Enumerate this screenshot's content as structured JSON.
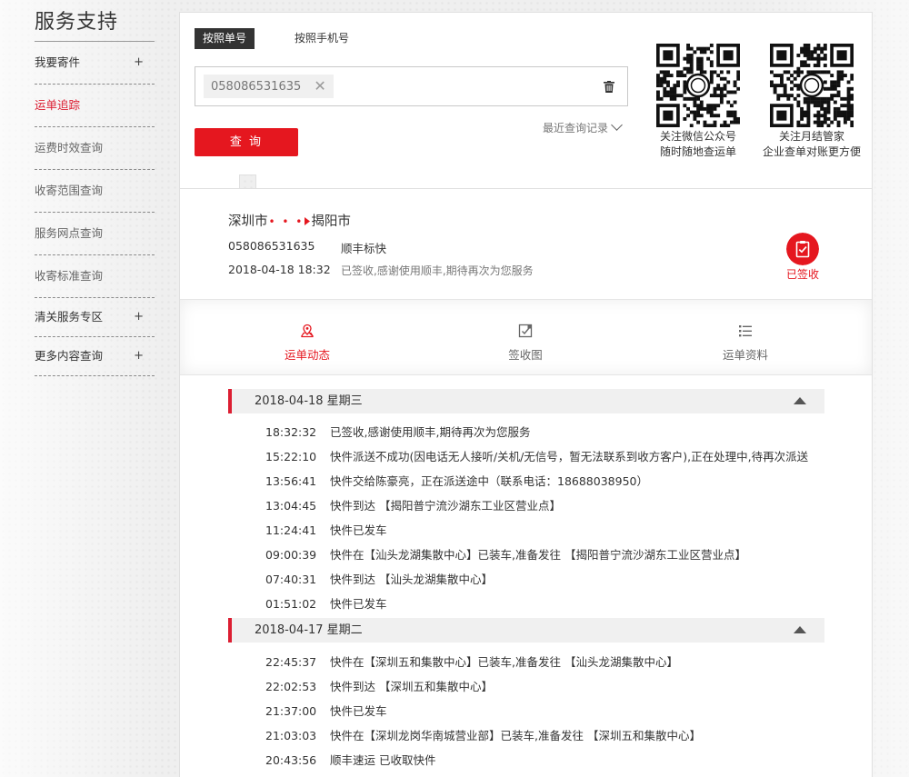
{
  "sidebar": {
    "title": "服务支持",
    "items": [
      {
        "label": "我要寄件",
        "plus": "+"
      },
      {
        "label": "运单追踪"
      },
      {
        "label": "运费时效查询"
      },
      {
        "label": "收寄范围查询"
      },
      {
        "label": "服务网点查询"
      },
      {
        "label": "收寄标准查询"
      },
      {
        "label": "清关服务专区",
        "plus": "+"
      },
      {
        "label": "更多内容查询",
        "plus": "+"
      }
    ]
  },
  "search": {
    "tab_waybill": "按照单号",
    "tab_phone": "按照手机号",
    "chip_value": "058086531635",
    "chip_remove": "✕",
    "recent_label": "最近查询记录",
    "query_button": "查 询",
    "qr1_caption_line1": "关注微信公众号",
    "qr1_caption_line2": "随时随地查运单",
    "qr2_caption_line1": "关注月结管家",
    "qr2_caption_line2": "企业查单对账更方便"
  },
  "summary": {
    "origin": "深圳市",
    "route_dots": "• • •",
    "destination": "揭阳市",
    "waybill": "058086531635",
    "service": "顺丰标快",
    "time": "2018-04-18 18:32",
    "status": "已签收,感谢使用顺丰,期待再次为您服务",
    "badge_label": "已签收"
  },
  "detail_tabs": [
    {
      "label": "运单动态"
    },
    {
      "label": "签收图"
    },
    {
      "label": "运单资料"
    }
  ],
  "days": [
    {
      "date": "2018-04-18 星期三",
      "events": [
        {
          "time": "18:32:32",
          "text": "已签收,感谢使用顺丰,期待再次为您服务"
        },
        {
          "time": "15:22:10",
          "text": "快件派送不成功(因电话无人接听/关机/无信号，暂无法联系到收方客户),正在处理中,待再次派送"
        },
        {
          "time": "13:56:41",
          "text": "快件交给陈豪亮，正在派送途中（联系电话：18688038950）"
        },
        {
          "time": "13:04:45",
          "text": "快件到达 【揭阳普宁流沙湖东工业区营业点】"
        },
        {
          "time": "11:24:41",
          "text": "快件已发车"
        },
        {
          "time": "09:00:39",
          "text": "快件在【汕头龙湖集散中心】已装车,准备发往 【揭阳普宁流沙湖东工业区营业点】"
        },
        {
          "time": "07:40:31",
          "text": "快件到达 【汕头龙湖集散中心】"
        },
        {
          "time": "01:51:02",
          "text": "快件已发车"
        }
      ]
    },
    {
      "date": "2018-04-17 星期二",
      "events": [
        {
          "time": "22:45:37",
          "text": "快件在【深圳五和集散中心】已装车,准备发往 【汕头龙湖集散中心】"
        },
        {
          "time": "22:02:53",
          "text": "快件到达 【深圳五和集散中心】"
        },
        {
          "time": "21:37:00",
          "text": "快件已发车"
        },
        {
          "time": "21:03:03",
          "text": "快件在【深圳龙岗华南城营业部】已装车,准备发往 【深圳五和集散中心】"
        },
        {
          "time": "20:43:56",
          "text": "顺丰速运 已收取快件"
        }
      ]
    }
  ],
  "colors": {
    "brand_red": "#e5171f",
    "accent_red": "#dc1e32",
    "dark_tab": "#333333"
  }
}
